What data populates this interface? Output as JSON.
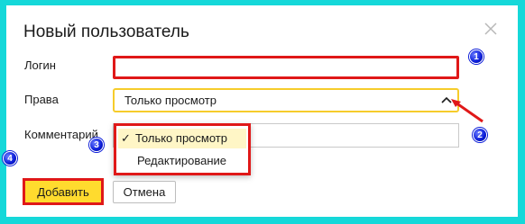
{
  "dialog": {
    "title": "Новый пользователь"
  },
  "form": {
    "login_label": "Логин",
    "login_value": "",
    "rights_label": "Права",
    "rights_value": "Только просмотр",
    "comment_label": "Комментарий",
    "comment_value": ""
  },
  "dropdown": {
    "check_glyph": "✓",
    "options": [
      "Только просмотр",
      "Редактирование"
    ],
    "selected": "Только просмотр"
  },
  "buttons": {
    "add": "Добавить",
    "cancel": "Отмена"
  },
  "badges": [
    "1",
    "2",
    "3",
    "4"
  ],
  "colors": {
    "background": "#15d8d9",
    "highlight_red": "#e01818",
    "primary_yellow": "#ffdb2e",
    "select_border": "#f6cc2b",
    "badge_blue": "#0a1bd8"
  }
}
